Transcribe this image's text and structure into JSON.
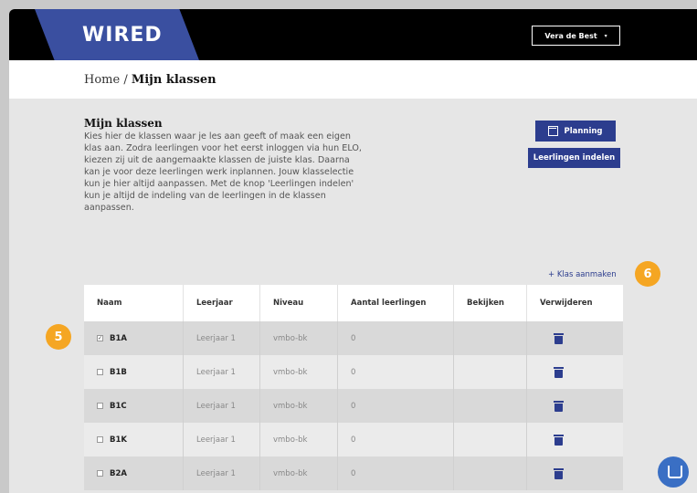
{
  "header": {
    "logo": "WIRED",
    "user": "Vera de Best",
    "user_chevron": "▾"
  },
  "breadcrumb": {
    "home": "Home",
    "separator": " / ",
    "current": "Mijn klassen"
  },
  "intro": {
    "title": "Mijn klassen",
    "text": "Kies hier de klassen waar je les aan geeft of maak een eigen klas aan. Zodra leerlingen voor het eerst inloggen via hun ELO, kiezen zij uit de aangemaakte klassen de juiste klas. Daarna kan je voor deze leerlingen werk inplannen. Jouw klasselectie kun je hier altijd aanpassen. Met de knop 'Leerlingen indelen' kun je altijd de indeling van de leerlingen in de klassen aanpassen."
  },
  "buttons": {
    "planning": "Planning",
    "indelen": "Leerlingen indelen",
    "add_klas": "+ Klas aanmaken"
  },
  "badges": {
    "five": "5",
    "six": "6"
  },
  "table": {
    "headers": [
      "Naam",
      "Leerjaar",
      "Niveau",
      "Aantal leerlingen",
      "Bekijken",
      "Verwijderen"
    ],
    "rows": [
      {
        "name": "B1A",
        "checked": true,
        "leerjaar": "Leerjaar 1",
        "niveau": "vmbo-bk",
        "aantal": "0"
      },
      {
        "name": "B1B",
        "checked": false,
        "leerjaar": "Leerjaar 1",
        "niveau": "vmbo-bk",
        "aantal": "0"
      },
      {
        "name": "B1C",
        "checked": false,
        "leerjaar": "Leerjaar 1",
        "niveau": "vmbo-bk",
        "aantal": "0"
      },
      {
        "name": "B1K",
        "checked": false,
        "leerjaar": "Leerjaar 1",
        "niveau": "vmbo-bk",
        "aantal": "0"
      },
      {
        "name": "B2A",
        "checked": false,
        "leerjaar": "Leerjaar 1",
        "niveau": "vmbo-bk",
        "aantal": "0"
      }
    ]
  },
  "colors": {
    "brand_blue": "#2c3d8e",
    "badge_orange": "#f5a623"
  }
}
